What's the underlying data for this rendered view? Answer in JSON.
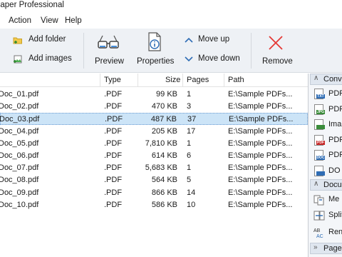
{
  "window": {
    "title": "haper Professional"
  },
  "menu": [
    "Action",
    "View",
    "Help"
  ],
  "toolbar": {
    "add_folder": "Add folder",
    "add_images": "Add images",
    "preview": "Preview",
    "properties": "Properties",
    "move_up": "Move up",
    "move_down": "Move down",
    "remove": "Remove"
  },
  "columns": {
    "type": "Type",
    "size": "Size",
    "pages": "Pages",
    "path": "Path"
  },
  "files": [
    {
      "name": "Doc_01.pdf",
      "type": ".PDF",
      "size": "99 KB",
      "pages": "1",
      "path": "E:\\Sample PDFs..."
    },
    {
      "name": "Doc_02.pdf",
      "type": ".PDF",
      "size": "470 KB",
      "pages": "3",
      "path": "E:\\Sample PDFs..."
    },
    {
      "name": "Doc_03.pdf",
      "type": ".PDF",
      "size": "487 KB",
      "pages": "37",
      "path": "E:\\Sample PDFs..."
    },
    {
      "name": "Doc_04.pdf",
      "type": ".PDF",
      "size": "205 KB",
      "pages": "17",
      "path": "E:\\Sample PDFs..."
    },
    {
      "name": "Doc_05.pdf",
      "type": ".PDF",
      "size": "7,810 KB",
      "pages": "1",
      "path": "E:\\Sample PDFs..."
    },
    {
      "name": "Doc_06.pdf",
      "type": ".PDF",
      "size": "614 KB",
      "pages": "6",
      "path": "E:\\Sample PDFs..."
    },
    {
      "name": "Doc_07.pdf",
      "type": ".PDF",
      "size": "5,683 KB",
      "pages": "1",
      "path": "E:\\Sample PDFs..."
    },
    {
      "name": "Doc_08.pdf",
      "type": ".PDF",
      "size": "564 KB",
      "pages": "5",
      "path": "E:\\Sample PDFs..."
    },
    {
      "name": "Doc_09.pdf",
      "type": ".PDF",
      "size": "866 KB",
      "pages": "14",
      "path": "E:\\Sample PDFs..."
    },
    {
      "name": "Doc_10.pdf",
      "type": ".PDF",
      "size": "586 KB",
      "pages": "10",
      "path": "E:\\Sample PDFs..."
    }
  ],
  "selected_file": "Doc_03.pdf",
  "side_panel": {
    "convert_header": "Conve",
    "convert_items": [
      {
        "label": "PDF",
        "tag": "TXT",
        "tag_color": "#2f6db5"
      },
      {
        "label": "PDF",
        "tag": "JPG",
        "tag_color": "#3a8c3a"
      },
      {
        "label": "Ima",
        "tag": "",
        "tag_color": "#3a8c3a"
      },
      {
        "label": "PDF",
        "tag": "PDF",
        "tag_color": "#c62828"
      },
      {
        "label": "PDF",
        "tag": "DOC",
        "tag_color": "#2f6db5"
      },
      {
        "label": "DO",
        "tag": "",
        "tag_color": "#2f6db5"
      }
    ],
    "document_header": "Docu",
    "document_items": [
      {
        "label": "Me",
        "icon": "merge-icon"
      },
      {
        "label": "Split",
        "icon": "split-icon"
      },
      {
        "label": "Ren",
        "icon": "rename-icon"
      }
    ],
    "pages_header": "Pages"
  },
  "colors": {
    "selection": "#cce4f7",
    "remove_icon": "#e53935",
    "arrow_icon": "#2f6db5"
  }
}
